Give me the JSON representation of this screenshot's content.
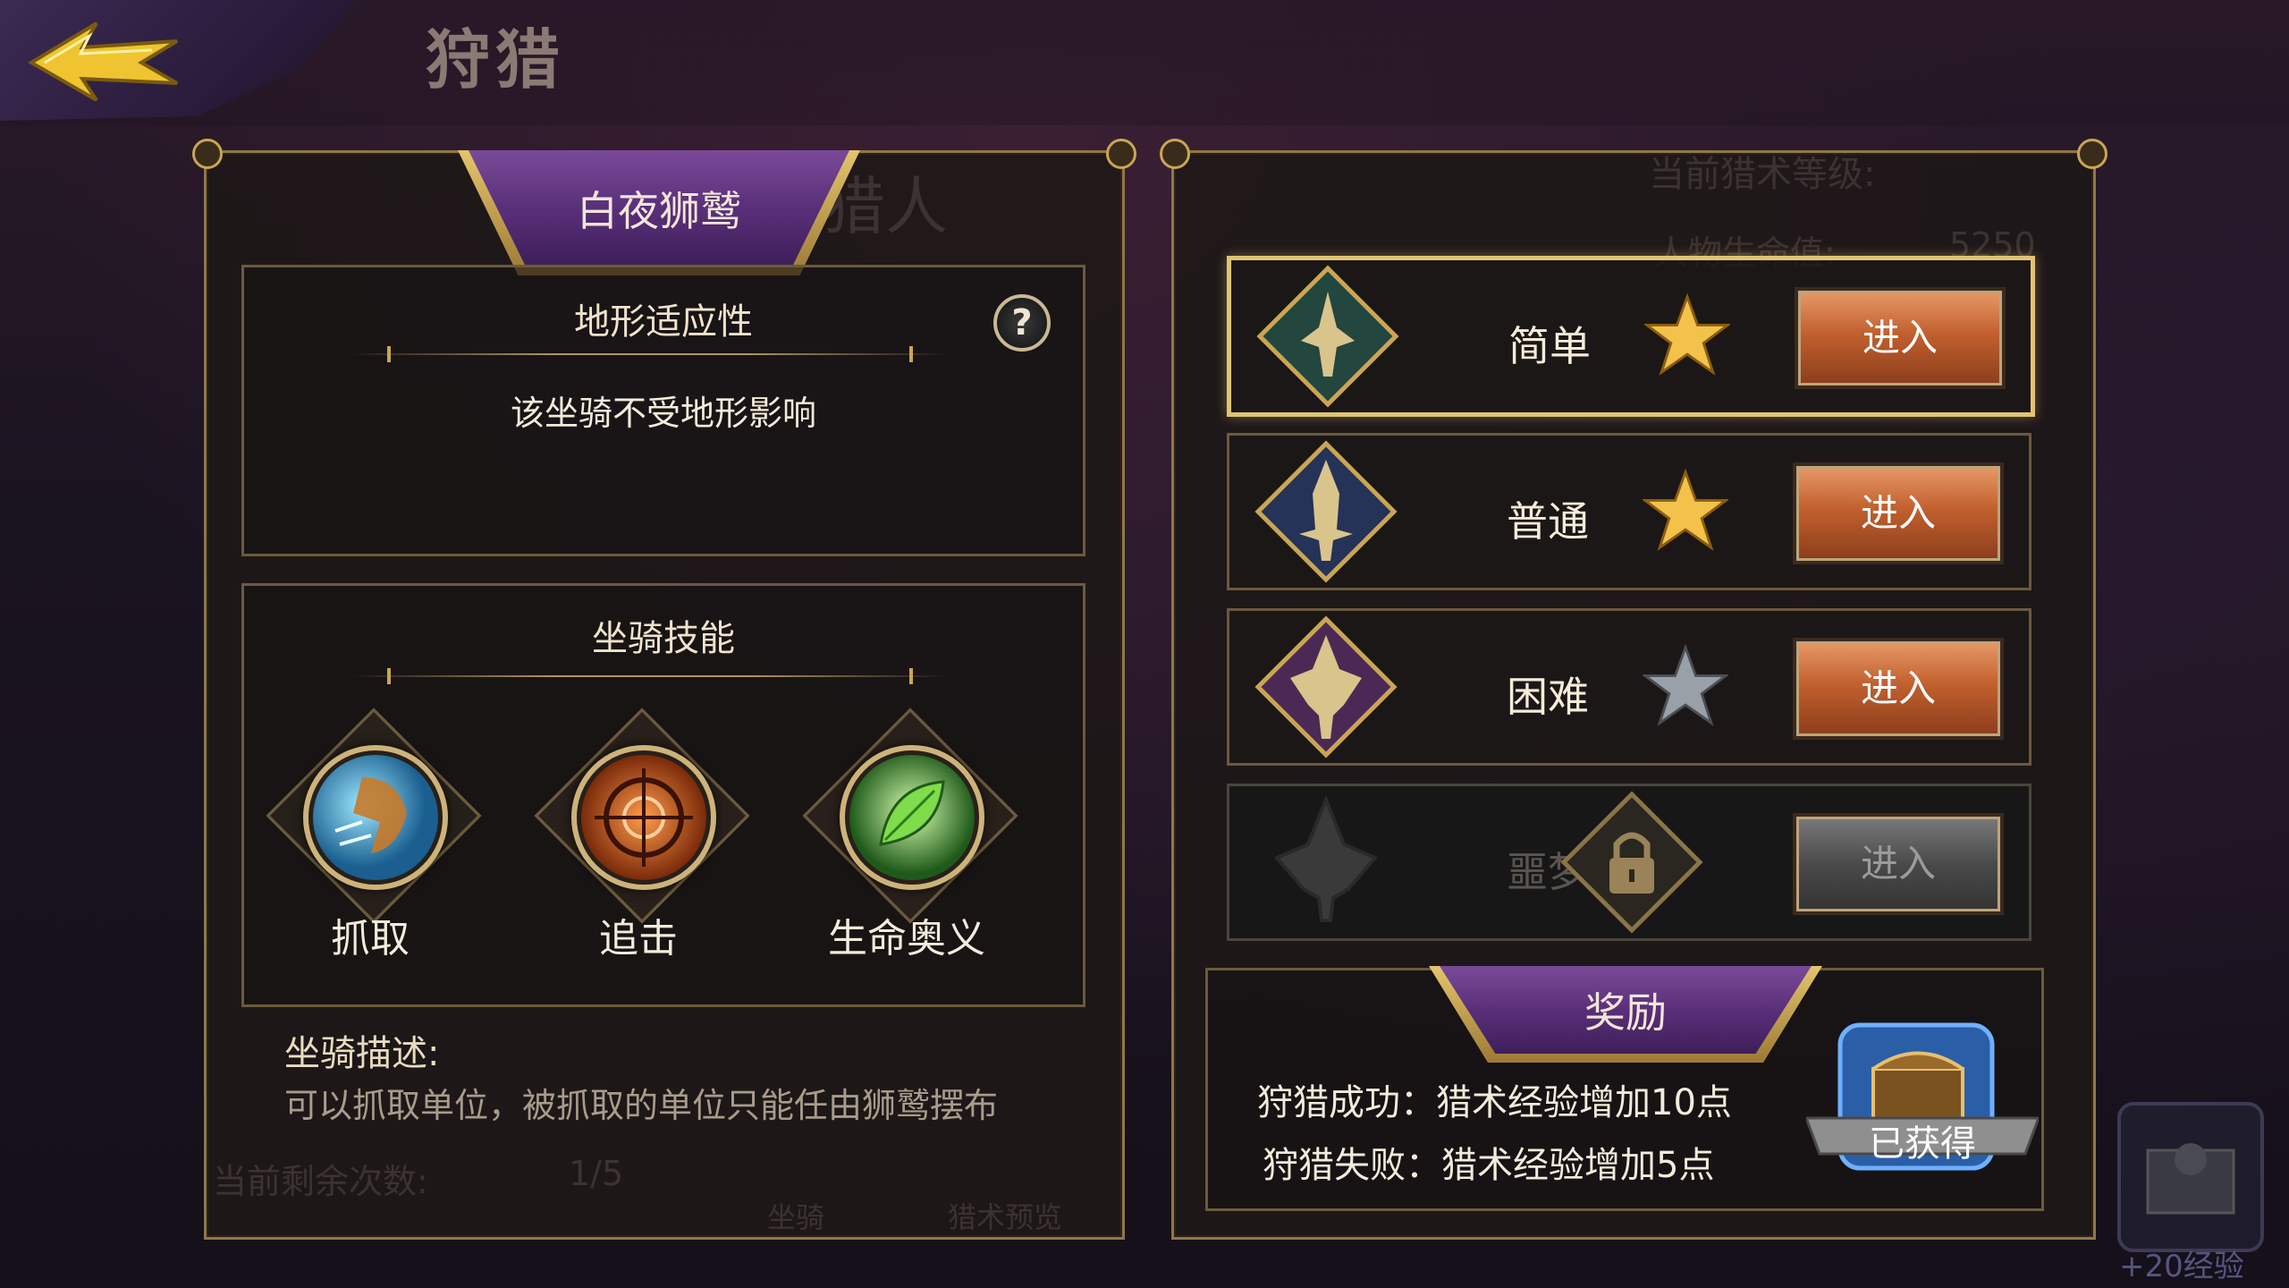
{
  "header": {
    "title": "狩猎"
  },
  "left_panel": {
    "mount_name": "白夜狮鹫",
    "bg_text": "猎人",
    "terrain": {
      "title": "地形适应性",
      "help": "?",
      "text": "该坐骑不受地形影响"
    },
    "skills": {
      "title": "坐骑技能",
      "items": [
        {
          "label": "抓取",
          "icon": "grab-skill-icon"
        },
        {
          "label": "追击",
          "icon": "target-skill-icon"
        },
        {
          "label": "生命奥义",
          "icon": "leaf-skill-icon"
        }
      ]
    },
    "description": {
      "title": "坐骑描述:",
      "text": "可以抓取单位，被抓取的单位只能任由狮鹫摆布"
    },
    "remaining": {
      "label": "当前剩余次数:",
      "value": "1/5"
    },
    "bottom_tabs": [
      "坐骑",
      "猎术预览"
    ]
  },
  "right_panel": {
    "bg_header": "当前猎术等级:",
    "bg_row": "人物生命值:",
    "bg_value": "5250",
    "difficulties": [
      {
        "label": "简单",
        "star": "gold",
        "button": "进入",
        "selected": true,
        "locked": false
      },
      {
        "label": "普通",
        "star": "gold",
        "button": "进入",
        "selected": false,
        "locked": false
      },
      {
        "label": "困难",
        "star": "gray",
        "button": "进入",
        "selected": false,
        "locked": false
      },
      {
        "label": "噩梦",
        "star": "gray",
        "button": "进入",
        "selected": false,
        "locked": true
      }
    ],
    "reward": {
      "title": "奖励",
      "success": "狩猎成功：猎术经验增加10点",
      "failure": "狩猎失败：猎术经验增加5点",
      "badge": "已获得"
    }
  },
  "corner_item": {
    "exp": "+20经验"
  },
  "colors": {
    "gold": "#e0c472",
    "purple": "#5a2f7a",
    "orange": "#c2602f"
  }
}
